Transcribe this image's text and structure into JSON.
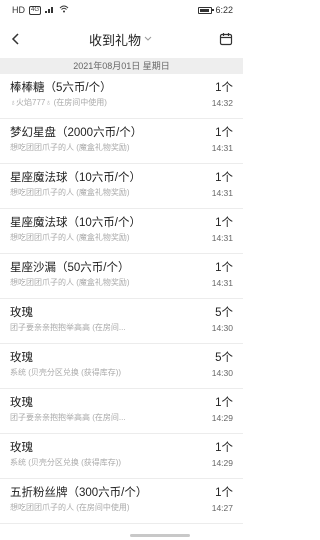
{
  "status_bar": {
    "left_text": "HD",
    "sim_badge": "4G",
    "time": "6:22"
  },
  "nav": {
    "title": "收到礼物",
    "back_icon": "chevron-left-icon",
    "calendar_icon": "calendar-icon"
  },
  "date_header": "2021年08月01日 星期日",
  "items": [
    {
      "name": "棒棒糖（5六币/个）",
      "sub": "♁火焰777♁ (在房间中使用)",
      "count": "1个",
      "time": "14:32"
    },
    {
      "name": "梦幻星盘（2000六币/个）",
      "sub": "想吃团团爪子的人 (魔盒礼物奖励)",
      "count": "1个",
      "time": "14:31"
    },
    {
      "name": "星座魔法球（10六币/个）",
      "sub": "想吃团团爪子的人 (魔盒礼物奖励)",
      "count": "1个",
      "time": "14:31"
    },
    {
      "name": "星座魔法球（10六币/个）",
      "sub": "想吃团团爪子的人 (魔盒礼物奖励)",
      "count": "1个",
      "time": "14:31"
    },
    {
      "name": "星座沙漏（50六币/个）",
      "sub": "想吃团团爪子的人 (魔盒礼物奖励)",
      "count": "1个",
      "time": "14:31"
    },
    {
      "name": "玫瑰",
      "sub": "团子要亲亲抱抱举高高 (在房间...",
      "count": "5个",
      "time": "14:30"
    },
    {
      "name": "玫瑰",
      "sub": "系统 (贝壳分区兑换 (获得库存))",
      "count": "5个",
      "time": "14:30"
    },
    {
      "name": "玫瑰",
      "sub": "团子要亲亲抱抱举高高 (在房间...",
      "count": "1个",
      "time": "14:29"
    },
    {
      "name": "玫瑰",
      "sub": "系统 (贝壳分区兑换 (获得库存))",
      "count": "1个",
      "time": "14:29"
    },
    {
      "name": "五折粉丝牌（300六币/个）",
      "sub": "想吃团团爪子的人 (在房间中使用)",
      "count": "1个",
      "time": "14:27"
    }
  ]
}
